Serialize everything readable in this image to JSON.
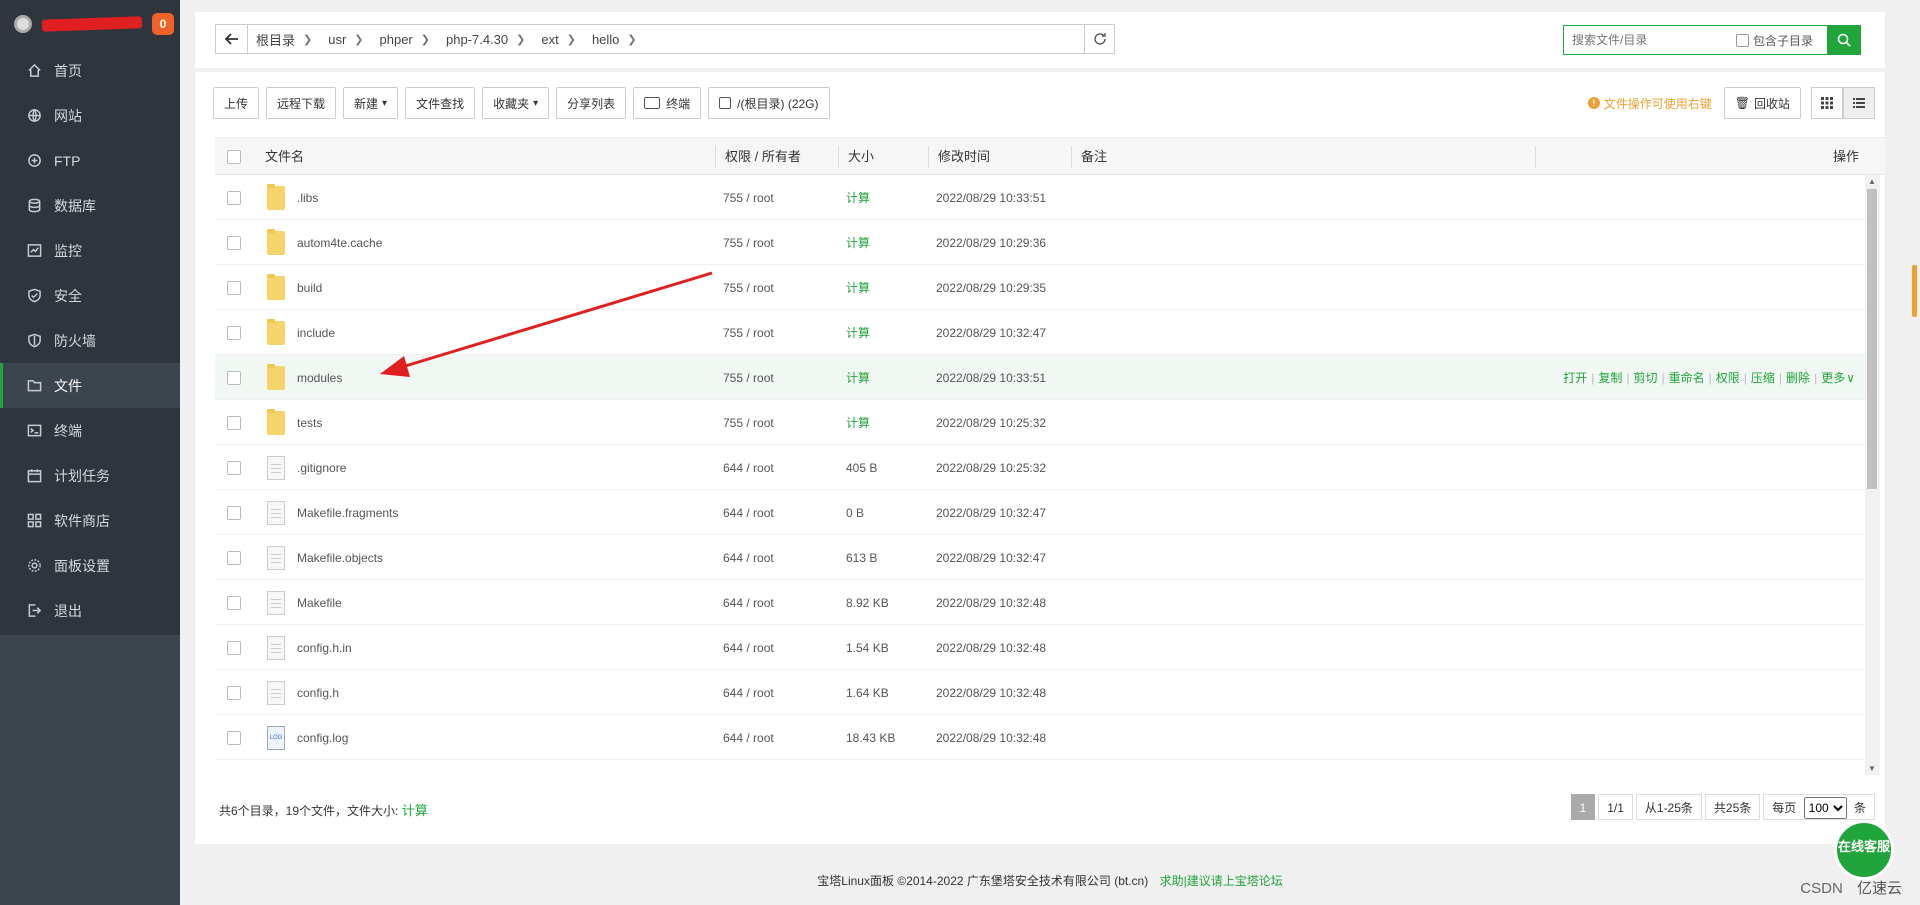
{
  "sidebar": {
    "badge": "0",
    "items": [
      {
        "label": "首页",
        "icon": "home-icon"
      },
      {
        "label": "网站",
        "icon": "globe-icon"
      },
      {
        "label": "FTP",
        "icon": "ftp-icon"
      },
      {
        "label": "数据库",
        "icon": "database-icon"
      },
      {
        "label": "监控",
        "icon": "monitor-icon"
      },
      {
        "label": "安全",
        "icon": "shield-icon"
      },
      {
        "label": "防火墙",
        "icon": "firewall-icon"
      },
      {
        "label": "文件",
        "icon": "folder-icon",
        "active": true
      },
      {
        "label": "终端",
        "icon": "terminal-icon"
      },
      {
        "label": "计划任务",
        "icon": "calendar-icon"
      },
      {
        "label": "软件商店",
        "icon": "apps-icon"
      },
      {
        "label": "面板设置",
        "icon": "gear-icon"
      },
      {
        "label": "退出",
        "icon": "logout-icon"
      }
    ]
  },
  "breadcrumb": [
    "根目录",
    "usr",
    "phper",
    "php-7.4.30",
    "ext",
    "hello"
  ],
  "search": {
    "placeholder": "搜索文件/目录",
    "include_sub": "包含子目录"
  },
  "toolbar": {
    "upload": "上传",
    "remote_download": "远程下载",
    "new": "新建",
    "file_search": "文件查找",
    "favorites": "收藏夹",
    "share_list": "分享列表",
    "terminal": "终端",
    "disk": "/(根目录) (22G)",
    "hint": "文件操作可使用右键",
    "recycle": "回收站"
  },
  "table": {
    "headers": {
      "name": "文件名",
      "perm": "权限 / 所有者",
      "size": "大小",
      "mtime": "修改时间",
      "note": "备注",
      "ops": "操作"
    },
    "rows": [
      {
        "name": ".libs",
        "type": "folder",
        "perm": "755 / root",
        "size": "计算",
        "mtime": "2022/08/29 10:33:51"
      },
      {
        "name": "autom4te.cache",
        "type": "folder",
        "perm": "755 / root",
        "size": "计算",
        "mtime": "2022/08/29 10:29:36"
      },
      {
        "name": "build",
        "type": "folder",
        "perm": "755 / root",
        "size": "计算",
        "mtime": "2022/08/29 10:29:35"
      },
      {
        "name": "include",
        "type": "folder",
        "perm": "755 / root",
        "size": "计算",
        "mtime": "2022/08/29 10:32:47"
      },
      {
        "name": "modules",
        "type": "folder",
        "perm": "755 / root",
        "size": "计算",
        "mtime": "2022/08/29 10:33:51"
      },
      {
        "name": "tests",
        "type": "folder",
        "perm": "755 / root",
        "size": "计算",
        "mtime": "2022/08/29 10:25:32"
      },
      {
        "name": ".gitignore",
        "type": "file",
        "perm": "644 / root",
        "size": "405 B",
        "mtime": "2022/08/29 10:25:32"
      },
      {
        "name": "Makefile.fragments",
        "type": "file",
        "perm": "644 / root",
        "size": "0 B",
        "mtime": "2022/08/29 10:32:47"
      },
      {
        "name": "Makefile.objects",
        "type": "file",
        "perm": "644 / root",
        "size": "613 B",
        "mtime": "2022/08/29 10:32:47"
      },
      {
        "name": "Makefile",
        "type": "file",
        "perm": "644 / root",
        "size": "8.92 KB",
        "mtime": "2022/08/29 10:32:48"
      },
      {
        "name": "config.h.in",
        "type": "file",
        "perm": "644 / root",
        "size": "1.54 KB",
        "mtime": "2022/08/29 10:32:48"
      },
      {
        "name": "config.h",
        "type": "file",
        "perm": "644 / root",
        "size": "1.64 KB",
        "mtime": "2022/08/29 10:32:48"
      },
      {
        "name": "config.log",
        "type": "log",
        "perm": "644 / root",
        "size": "18.43 KB",
        "mtime": "2022/08/29 10:32:48"
      }
    ],
    "row_actions": [
      "打开",
      "复制",
      "剪切",
      "重命名",
      "权限",
      "压缩",
      "删除",
      "更多"
    ]
  },
  "summary": {
    "text": "共6个目录，19个文件，文件大小:",
    "calc": "计算"
  },
  "pager": {
    "current": "1",
    "pages": "1/1",
    "range": "从1-25条",
    "total": "共25条",
    "per_page_label": "每页",
    "per_page": "100",
    "unit": "条"
  },
  "footer": {
    "copyright": "宝塔Linux面板 ©2014-2022 广东堡塔安全技术有限公司 (bt.cn)",
    "link": "求助|建议请上宝塔论坛"
  },
  "watermark": {
    "csdn": "CSDN",
    "brand": "亿速云"
  },
  "online_service": "在线客服",
  "colors": {
    "accent": "#20a53a",
    "sidebar": "#3c444d",
    "hint": "#f0a030",
    "arrow": "#e02020"
  }
}
